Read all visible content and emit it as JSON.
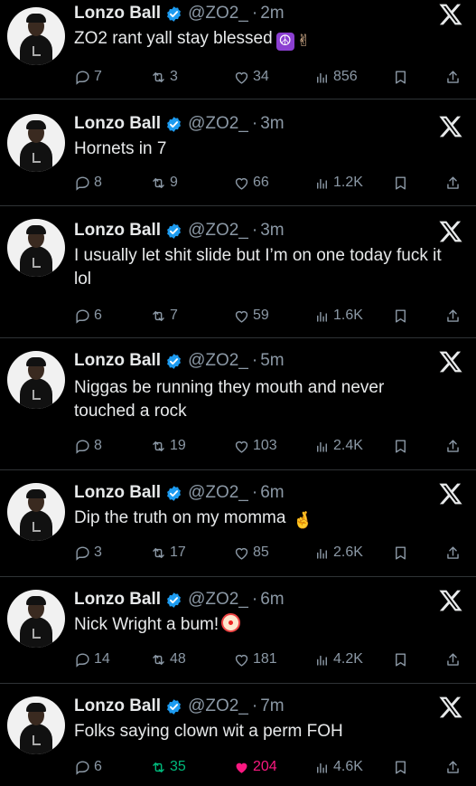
{
  "tweets": [
    {
      "name": "Lonzo Ball",
      "handle": "@ZO2_",
      "time": "2m",
      "text": "ZO2 rant yall stay blessed",
      "emoji": [
        "peace-symbol",
        "victory-hand"
      ],
      "replies": "7",
      "retweets": "3",
      "likes": "34",
      "views": "856",
      "liked": false,
      "retweeted": false
    },
    {
      "name": "Lonzo Ball",
      "handle": "@ZO2_",
      "time": "3m",
      "text": "Hornets in 7",
      "emoji": [],
      "replies": "8",
      "retweets": "9",
      "likes": "66",
      "views": "1.2K",
      "liked": false,
      "retweeted": false
    },
    {
      "name": "Lonzo Ball",
      "handle": "@ZO2_",
      "time": "3m",
      "text": "I usually let shit slide but I’m on one today fuck it lol",
      "emoji": [],
      "replies": "6",
      "retweets": "7",
      "likes": "59",
      "views": "1.6K",
      "liked": false,
      "retweeted": false
    },
    {
      "name": "Lonzo Ball",
      "handle": "@ZO2_",
      "time": "5m",
      "text": "Niggas be running they mouth and never touched a rock",
      "emoji": [],
      "replies": "8",
      "retweets": "19",
      "likes": "103",
      "views": "2.4K",
      "liked": false,
      "retweeted": false
    },
    {
      "name": "Lonzo Ball",
      "handle": "@ZO2_",
      "time": "6m",
      "text": "Dip the truth on my momma",
      "emoji": [
        "crossed-fingers"
      ],
      "replies": "3",
      "retweets": "17",
      "likes": "85",
      "views": "2.6K",
      "liked": false,
      "retweeted": false
    },
    {
      "name": "Lonzo Ball",
      "handle": "@ZO2_",
      "time": "6m",
      "text": "Nick Wright a bum!",
      "emoji": [
        "clown-face"
      ],
      "replies": "14",
      "retweets": "48",
      "likes": "181",
      "views": "4.2K",
      "liked": false,
      "retweeted": false
    },
    {
      "name": "Lonzo Ball",
      "handle": "@ZO2_",
      "time": "7m",
      "text": "Folks saying clown wit a perm FOH",
      "emoji": [],
      "replies": "6",
      "retweets": "35",
      "likes": "204",
      "views": "4.6K",
      "liked": true,
      "retweeted": true
    }
  ],
  "colors": {
    "verified": "#1d9bf0",
    "like_active": "#f91880",
    "retweet_active": "#00ba7c",
    "muted": "#8b98a5"
  }
}
